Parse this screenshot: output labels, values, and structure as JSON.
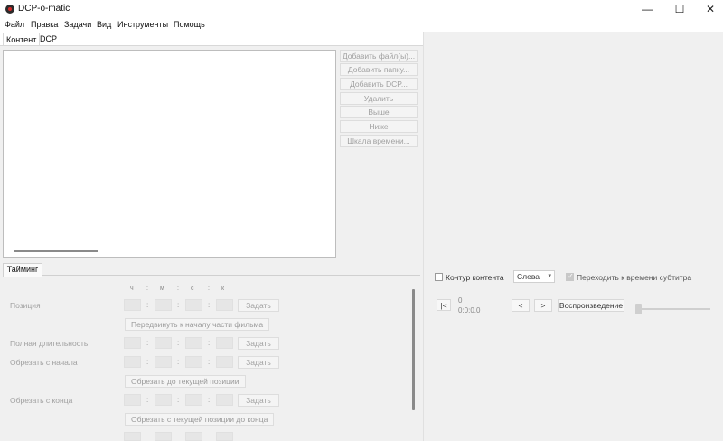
{
  "window": {
    "title": "DCP-o-matic",
    "controls": {
      "minimize": "—",
      "maximize": "☐",
      "close": "✕"
    }
  },
  "menu": [
    "Файл",
    "Правка",
    "Задачи",
    "Вид",
    "Инструменты",
    "Помощь"
  ],
  "tabs": [
    "Контент",
    "DCP"
  ],
  "content_buttons": [
    "Добавить файл(ы)...",
    "Добавить папку...",
    "Добавить DCP...",
    "Удалить",
    "Выше",
    "Ниже",
    "Шкала времени..."
  ],
  "timing": {
    "tab": "Тайминг",
    "headers": [
      "ч",
      ":",
      "м",
      ":",
      "с",
      ":",
      "к"
    ],
    "set_label": "Задать",
    "position_label": "Позиция",
    "move_to_reel_start": "Передвинуть к началу части фильма",
    "full_length_label": "Полная длительность",
    "trim_start_label": "Обрезать с начала",
    "trim_to_current": "Обрезать до текущей позиции",
    "trim_end_label": "Обрезать с конца",
    "trim_from_current_to_end": "Обрезать с текущей позиции до конца"
  },
  "viewer": {
    "outline_content": "Контур контента",
    "eye_select": "Слева",
    "jump_to_subtitle": "Переходить к времени субтитра",
    "jump_to_subtitle_checked": true,
    "go_start": "|<",
    "frame": "0",
    "timecode": "0:0:0.0",
    "back": "<",
    "forward": ">",
    "play": "Воспроизведение",
    "slider_position": 0
  },
  "icons": {
    "app": "dcp-o-matic-logo-icon",
    "chevron": "chevron-down-icon"
  }
}
